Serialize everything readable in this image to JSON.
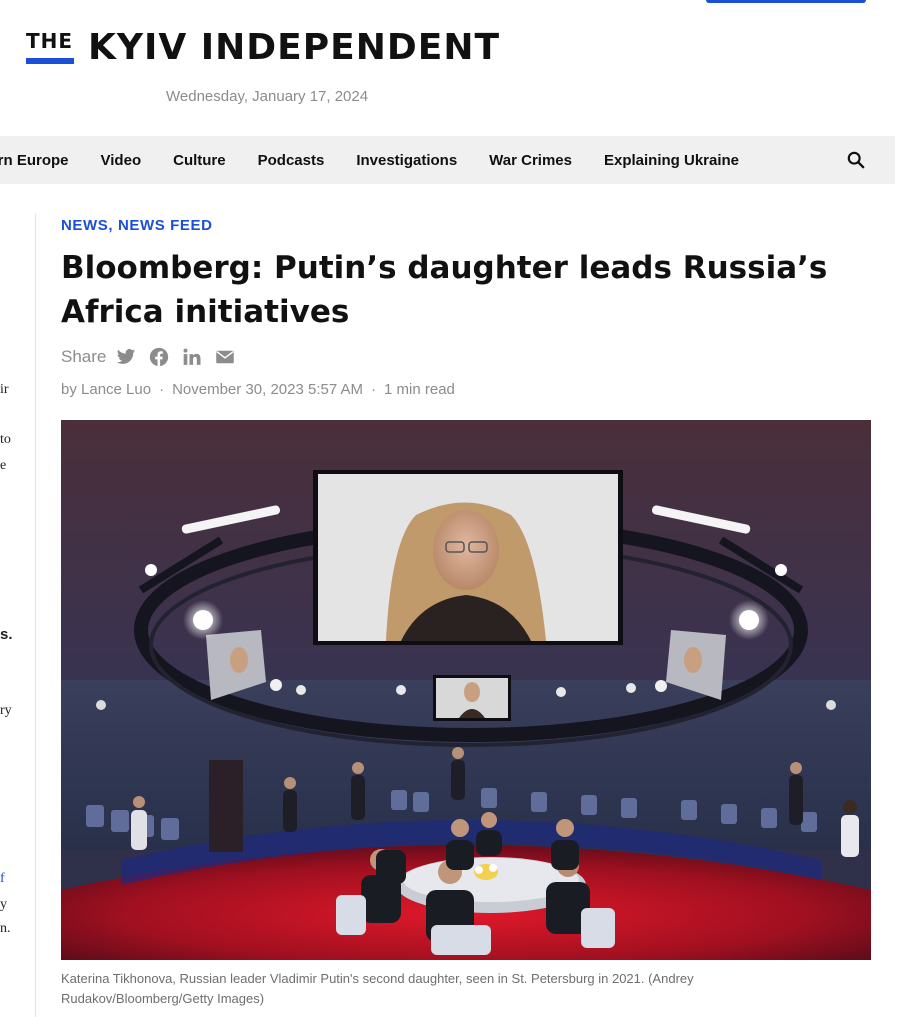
{
  "logo": {
    "the": "THE",
    "name": "KYIV INDEPENDENT"
  },
  "date": "Wednesday, January 17, 2024",
  "nav": {
    "items": [
      "stern Europe",
      "Video",
      "Culture",
      "Podcasts",
      "Investigations",
      "War Crimes",
      "Explaining Ukraine"
    ],
    "search_icon": "search-icon"
  },
  "left_column_fragments": [
    {
      "text": "ir",
      "style": "normal"
    },
    {
      "text": "to",
      "style": "normal"
    },
    {
      "text": "e",
      "style": "normal"
    },
    {
      "text": "s.",
      "style": "bold"
    },
    {
      "text": "ry",
      "style": "normal"
    },
    {
      "text": "f",
      "style": "link"
    },
    {
      "text": "y",
      "style": "normal"
    },
    {
      "text": "n.",
      "style": "normal"
    }
  ],
  "article": {
    "categories": [
      "NEWS",
      "NEWS FEED"
    ],
    "category_separator": ",",
    "title": "Bloomberg: Putin’s daughter leads Russia’s Africa initiatives",
    "share_label": "Share",
    "share_icons": [
      "twitter-icon",
      "facebook-icon",
      "linkedin-icon",
      "email-icon"
    ],
    "author": "by Lance Luo",
    "published": "November 30, 2023 5:57 AM",
    "read_time": "1 min read",
    "separator": "·",
    "caption": "Katerina Tikhonova, Russian leader Vladimir Putin's second daughter, seen in St. Petersburg in 2021. (Andrey Rudakov/Bloomberg/Getty Images)"
  },
  "colors": {
    "accent": "#1a4fd6",
    "nav_bg": "#f0f0f0",
    "muted_text": "#8c8c8c"
  }
}
